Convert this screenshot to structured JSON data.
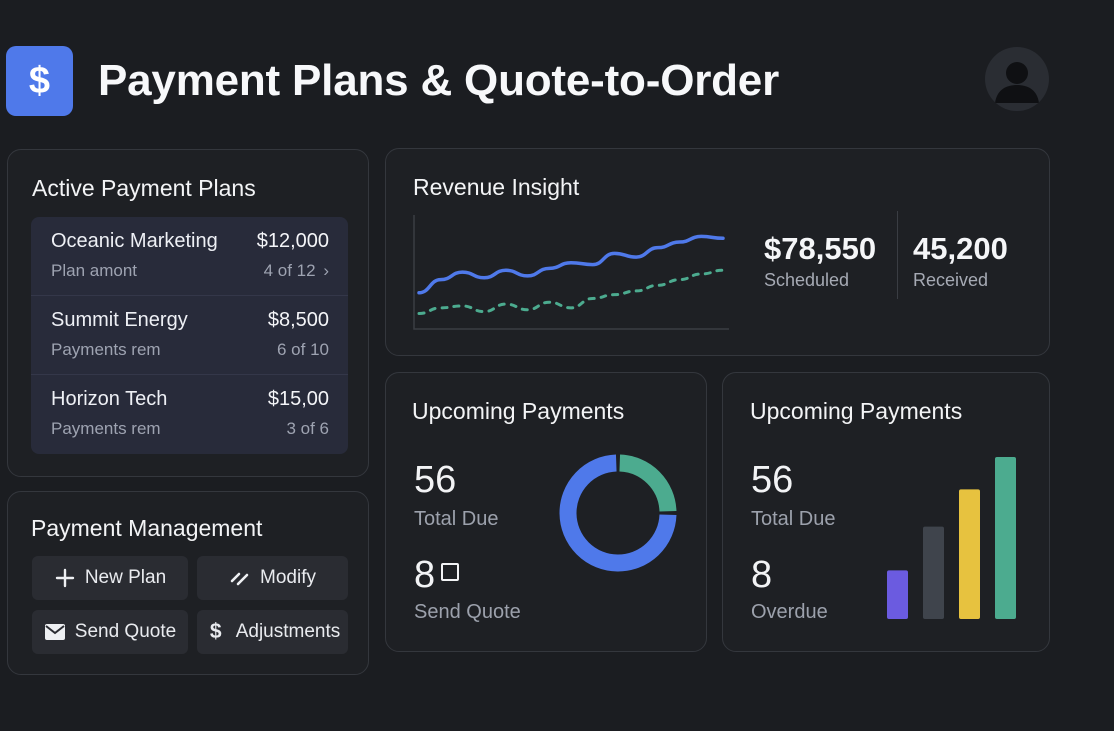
{
  "header": {
    "logo_symbol": "$",
    "title": "Payment Plans & Quote-to-Order",
    "avatar_icon": "user-avatar-icon"
  },
  "plans": {
    "title": "Active Payment Plans",
    "items": [
      {
        "name": "Oceanic Marketing",
        "amount": "$12,000",
        "sub": "Plan amont",
        "progress": "4 of 12",
        "chevron": "›"
      },
      {
        "name": "Summit Energy",
        "amount": "$8,500",
        "sub": "Payments rem",
        "progress": "6 of 10"
      },
      {
        "name": "Horizon Tech",
        "amount": "$15,00",
        "sub": "Payments rem",
        "progress": "3 of 6"
      }
    ]
  },
  "management": {
    "title": "Payment Management",
    "buttons": {
      "new_plan": "New Plan",
      "modify": "Modify",
      "send_quote": "Send Quote",
      "adjustments": "Adjustments"
    }
  },
  "revenue": {
    "title": "Revenue Insight",
    "scheduled_value": "$78,550",
    "scheduled_label": "Scheduled",
    "received_value": "45,200",
    "received_label": "Received"
  },
  "upcoming_left": {
    "title": "Upcoming Payments",
    "total_due_value": "56",
    "total_due_label": "Total Due",
    "send_quote_value": "8",
    "send_quote_label": "Send Quote"
  },
  "upcoming_right": {
    "title": "Upcoming Payments",
    "total_due_value": "56",
    "total_due_label": "Total Due",
    "overdue_value": "8",
    "overdue_label": "Overdue"
  },
  "colors": {
    "accent_blue": "#4f79ea",
    "teal": "#4cab8f",
    "yellow": "#e7c23f",
    "purple": "#6b5be0",
    "slate": "#3f444c"
  },
  "chart_data": [
    {
      "type": "line",
      "series": [
        {
          "values": [
            30,
            44,
            52,
            46,
            54,
            48,
            56,
            62,
            60,
            72,
            68,
            78,
            84,
            90,
            88
          ]
        },
        {
          "values": [
            8,
            14,
            16,
            10,
            18,
            12,
            20,
            14,
            24,
            28,
            32,
            38,
            44,
            50,
            54
          ]
        }
      ],
      "legend": "none",
      "grid": false
    },
    {
      "type": "pie",
      "values": [
        25,
        75
      ]
    },
    {
      "type": "bar",
      "values": [
        30,
        57,
        80,
        100
      ]
    }
  ]
}
